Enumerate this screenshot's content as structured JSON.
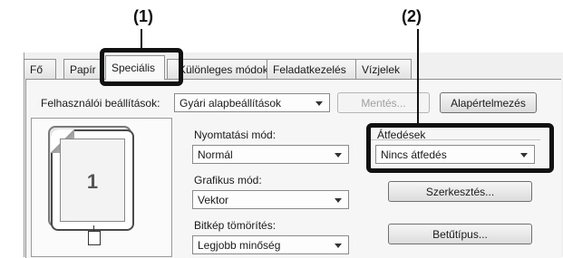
{
  "callouts": {
    "one": "(1)",
    "two": "(2)"
  },
  "tabs": [
    {
      "label": "Fő"
    },
    {
      "label": "Papír"
    },
    {
      "label": "Speciális"
    },
    {
      "label": "Különleges módok"
    },
    {
      "label": "Feladatkezelés"
    },
    {
      "label": "Vízjelek"
    }
  ],
  "user_settings": {
    "label": "Felhasználói beállítások:",
    "value": "Gyári alapbeállítások",
    "save_label": "Mentés...",
    "defaults_label": "Alapértelmezés"
  },
  "preview": {
    "page_number": "1"
  },
  "print_mode": {
    "label": "Nyomtatási mód:",
    "value": "Normál"
  },
  "graphics_mode": {
    "label": "Grafikus mód:",
    "value": "Vektor"
  },
  "bitmap_compression": {
    "label": "Bitkép tömörítés:",
    "value": "Legjobb minőség"
  },
  "overlays": {
    "label": "Átfedések",
    "value": "Nincs átfedés",
    "edit_label": "Szerkesztés..."
  },
  "font_type_label": "Betűtípus...",
  "colors": {
    "highlight": "#111111",
    "tab_border": "#8e8f8f"
  }
}
